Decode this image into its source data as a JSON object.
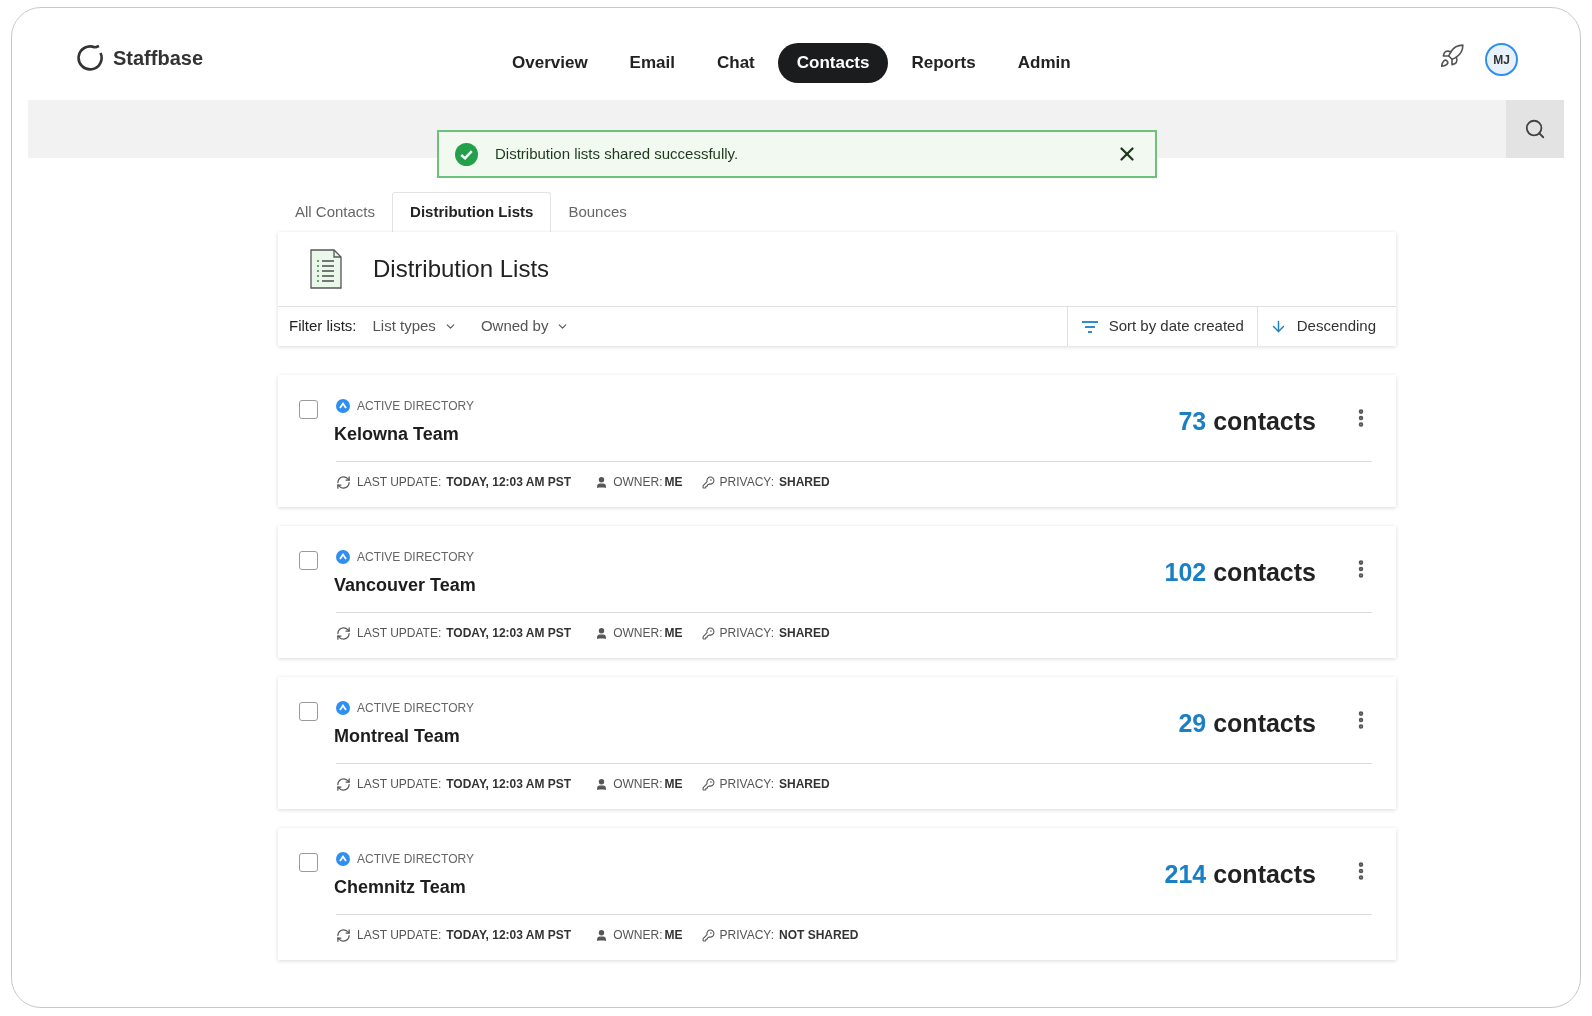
{
  "brand": {
    "name": "Staffbase"
  },
  "nav": [
    {
      "label": "Overview",
      "selected": false
    },
    {
      "label": "Email",
      "selected": false
    },
    {
      "label": "Chat",
      "selected": false
    },
    {
      "label": "Contacts",
      "selected": true
    },
    {
      "label": "Reports",
      "selected": false
    },
    {
      "label": "Admin",
      "selected": false
    }
  ],
  "user": {
    "initials": "MJ"
  },
  "toast": {
    "message": "Distribution lists shared successfully."
  },
  "tabs": [
    {
      "label": "All Contacts",
      "selected": false
    },
    {
      "label": "Distribution Lists",
      "selected": true
    },
    {
      "label": "Bounces",
      "selected": false
    }
  ],
  "panel": {
    "title": "Distribution Lists"
  },
  "filters": {
    "label": "Filter lists:",
    "dropdowns": [
      "List types",
      "Owned by"
    ],
    "sort": "Sort by date created",
    "order": "Descending"
  },
  "lists": [
    {
      "checked": false,
      "source": "ACTIVE DIRECTORY",
      "name": "Kelowna Team",
      "count": "73",
      "count_label": "contacts",
      "update_label": "LAST UPDATE:",
      "update": "TODAY, 12:03 AM PST",
      "owner_label": "OWNER:",
      "owner": "ME",
      "privacy_label": "PRIVACY:",
      "privacy": "SHARED"
    },
    {
      "checked": false,
      "source": "ACTIVE DIRECTORY",
      "name": "Vancouver Team",
      "count": "102",
      "count_label": "contacts",
      "update_label": "LAST UPDATE:",
      "update": "TODAY, 12:03 AM PST",
      "owner_label": "OWNER:",
      "owner": "ME",
      "privacy_label": "PRIVACY:",
      "privacy": "SHARED"
    },
    {
      "checked": false,
      "source": "ACTIVE DIRECTORY",
      "name": "Montreal Team",
      "count": "29",
      "count_label": "contacts",
      "update_label": "LAST UPDATE:",
      "update": "TODAY, 12:03 AM PST",
      "owner_label": "OWNER:",
      "owner": "ME",
      "privacy_label": "PRIVACY:",
      "privacy": "SHARED"
    },
    {
      "checked": false,
      "source": "ACTIVE DIRECTORY",
      "name": "Chemnitz Team",
      "count": "214",
      "count_label": "contacts",
      "update_label": "LAST UPDATE:",
      "update": "TODAY, 12:03 AM PST",
      "owner_label": "OWNER:",
      "owner": "ME",
      "privacy_label": "PRIVACY:",
      "privacy": "NOT SHARED"
    }
  ]
}
